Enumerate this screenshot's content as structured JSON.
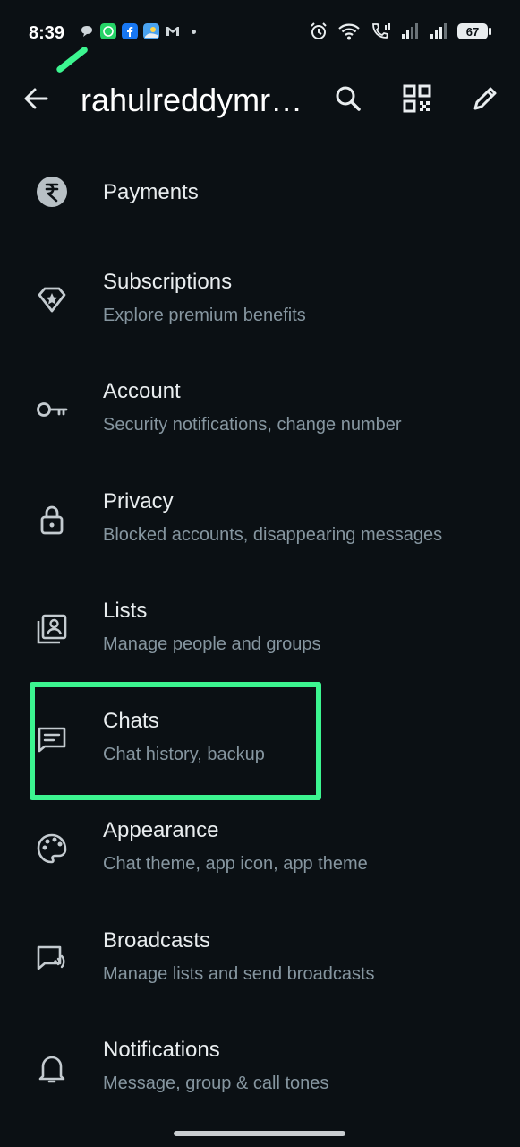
{
  "status_bar": {
    "time": "8:39",
    "battery": "67",
    "notification_icons": [
      "chat-bubble-icon",
      "whatsapp-icon",
      "facebook-icon",
      "photos-icon",
      "gmail-icon"
    ],
    "system_icons": [
      "alarm-icon",
      "wifi-icon",
      "call-signal-icon",
      "signal-icon",
      "signal-icon",
      "battery-icon"
    ]
  },
  "header": {
    "title": "rahulreddymr…",
    "actions": [
      "search-icon",
      "qr-code-icon",
      "edit-icon"
    ]
  },
  "settings": {
    "items": [
      {
        "label": "Payments",
        "subtitle": "",
        "icon": "rupee-icon"
      },
      {
        "label": "Subscriptions",
        "subtitle": "Explore premium benefits",
        "icon": "diamond-star-icon"
      },
      {
        "label": "Account",
        "subtitle": "Security notifications, change number",
        "icon": "key-icon"
      },
      {
        "label": "Privacy",
        "subtitle": "Blocked accounts, disappearing messages",
        "icon": "lock-icon"
      },
      {
        "label": "Lists",
        "subtitle": "Manage people and groups",
        "icon": "contacts-list-icon"
      },
      {
        "label": "Chats",
        "subtitle": "Chat history, backup",
        "icon": "chat-icon"
      },
      {
        "label": "Appearance",
        "subtitle": "Chat theme, app icon, app theme",
        "icon": "palette-icon"
      },
      {
        "label": "Broadcasts",
        "subtitle": "Manage lists and send broadcasts",
        "icon": "broadcast-icon"
      },
      {
        "label": "Notifications",
        "subtitle": "Message, group & call tones",
        "icon": "bell-icon"
      }
    ]
  },
  "colors": {
    "background": "#0b1014",
    "text_primary": "#e9edef",
    "text_secondary": "#8696a0",
    "highlight": "#3cf590"
  }
}
